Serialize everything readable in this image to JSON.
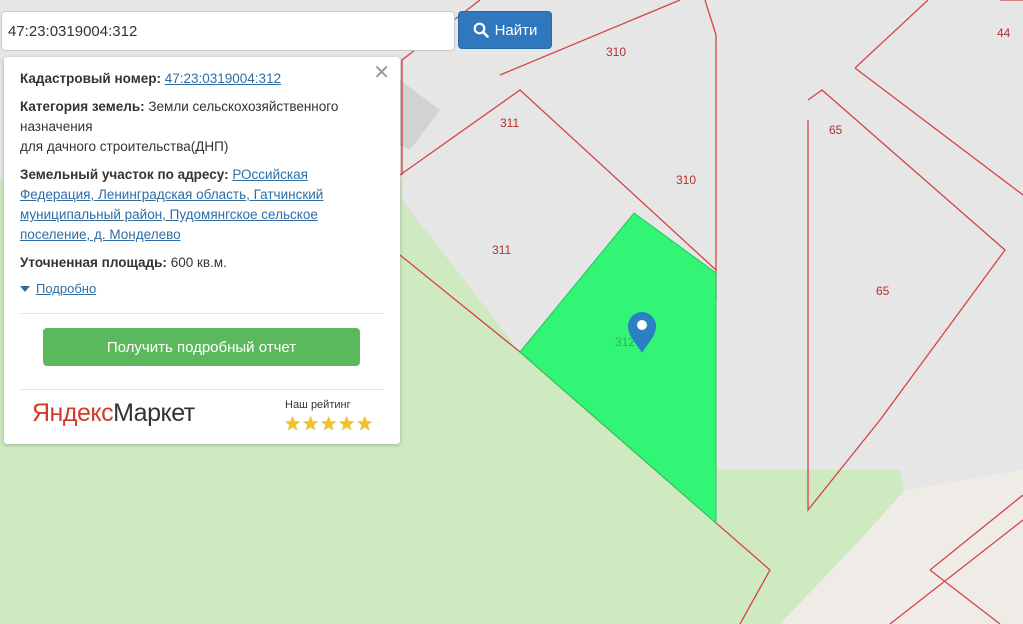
{
  "search": {
    "value": "47:23:0319004:312",
    "button_label": "Найти"
  },
  "info": {
    "cadastral_label": "Кадастровый номер:",
    "cadastral_value": "47:23:0319004:312",
    "category_label": "Категория земель:",
    "category_value_line1": "Земли сельскохозяйственного",
    "category_value_line2": "назначения",
    "category_value_line3": "для дачного строительства(ДНП)",
    "address_label": "Земельный участок по адресу:",
    "address_value": "РОссийская Федерация, Ленинградская область, Гатчинский муниципальный район, Пудомянгское сельское поселение, д. Монделево",
    "area_label": "Уточненная площадь:",
    "area_value": "600 кв.м.",
    "details_link": "Подробно",
    "report_button": "Получить подробный отчет",
    "logo_part1": "Яндекс",
    "logo_part2": "Маркет",
    "rating_label": "Наш рейтинг",
    "rating_stars": 5,
    "close_glyph": "✕"
  },
  "map": {
    "plot_labels": {
      "p310_top": "310",
      "p310_mid": "310",
      "p311_top": "311",
      "p311_mid": "311",
      "p65_top": "65",
      "p65_mid": "65",
      "p44": "44",
      "p312": "312"
    },
    "colors": {
      "background": "#e6e6e6",
      "green_zone": "#cfeac1",
      "selected_plot": "#33f575",
      "boundary": "#d64545"
    },
    "marker_icon": "map-pin-icon"
  }
}
